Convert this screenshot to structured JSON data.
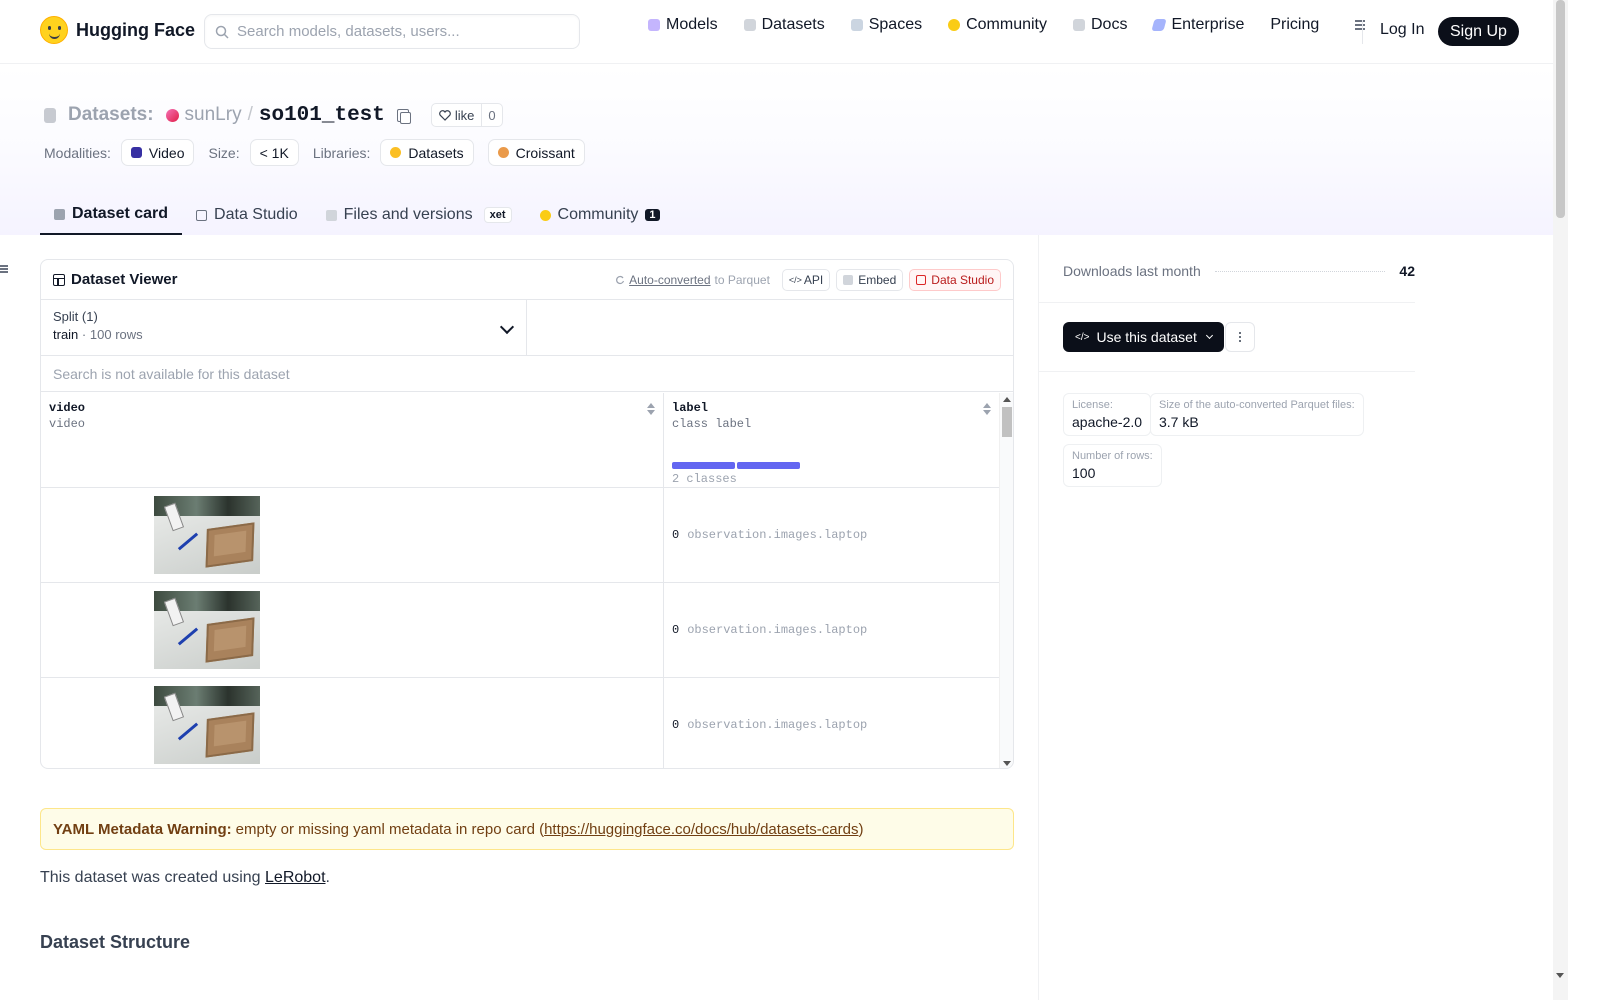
{
  "nav": {
    "brand": "Hugging Face",
    "search_placeholder": "Search models, datasets, users...",
    "links": [
      "Models",
      "Datasets",
      "Spaces",
      "Community",
      "Docs",
      "Enterprise",
      "Pricing"
    ],
    "login": "Log In",
    "signup": "Sign Up"
  },
  "header": {
    "prefix": "Datasets:",
    "user": "sunLry",
    "slash": "/",
    "repo": "so101_test",
    "like_label": "like",
    "like_count": "0",
    "modalities_label": "Modalities:",
    "modality": "Video",
    "size_label": "Size:",
    "size": "< 1K",
    "libraries_label": "Libraries:",
    "libraries": [
      "Datasets",
      "Croissant"
    ]
  },
  "tabs": [
    {
      "label": "Dataset card"
    },
    {
      "label": "Data Studio"
    },
    {
      "label": "Files and versions",
      "extra": "xet"
    },
    {
      "label": "Community",
      "badge": "1"
    }
  ],
  "viewer": {
    "title": "Dataset Viewer",
    "auto_converted": "Auto-converted",
    "to_parquet": "to Parquet",
    "api": "API",
    "embed": "Embed",
    "data_studio": "Data Studio",
    "split_label": "Split (1)",
    "split_name": "train",
    "split_dot": "·",
    "split_rows": "100 rows",
    "search_na": "Search is not available for this dataset",
    "columns": [
      {
        "name": "video",
        "type": "video"
      },
      {
        "name": "label",
        "type": "class label",
        "classes": "2 classes",
        "class_count": 2
      }
    ],
    "rows": [
      {
        "label_value": "0",
        "label_name": "observation.images.laptop"
      },
      {
        "label_value": "0",
        "label_name": "observation.images.laptop"
      },
      {
        "label_value": "0",
        "label_name": "observation.images.laptop"
      }
    ]
  },
  "card": {
    "warning_bold": "YAML Metadata Warning:",
    "warning_text": "empty or missing yaml metadata in repo card (",
    "warning_link": "https://huggingface.co/docs/hub/datasets-cards",
    "warning_close": ")",
    "para_prefix": "This dataset was created using ",
    "para_link": "LeRobot",
    "para_suffix": ".",
    "heading": "Dataset Structure"
  },
  "sidebar": {
    "downloads_label": "Downloads last month",
    "downloads_value": "42",
    "use_button": "Use this dataset",
    "license_label": "License:",
    "license_value": "apache-2.0",
    "parquet_size_label": "Size of the auto-converted Parquet files:",
    "parquet_size_value": "3.7 kB",
    "rows_label": "Number of rows:",
    "rows_value": "100"
  },
  "colors": {
    "accent_indigo": "#6366f1",
    "dark_button": "#0b0f19",
    "warning_bg": "#fefce8"
  }
}
